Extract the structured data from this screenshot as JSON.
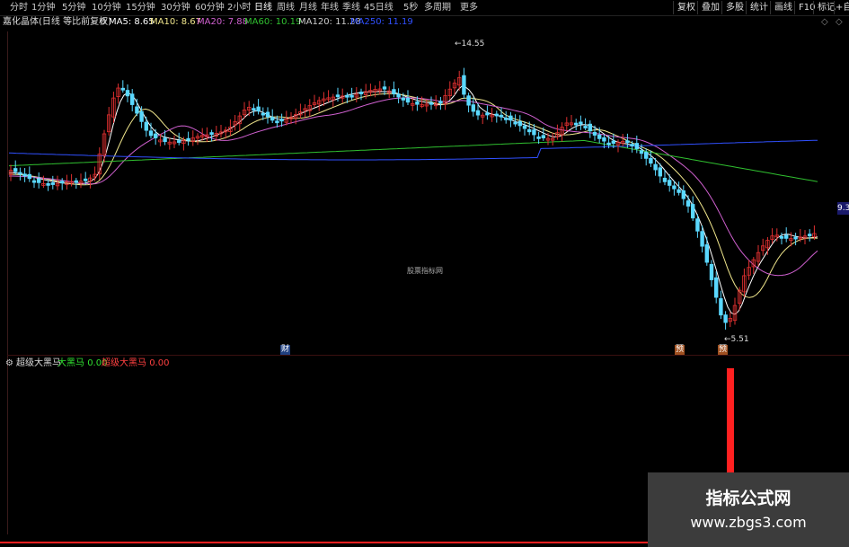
{
  "toolbar": {
    "periods": [
      "分时",
      "1分钟",
      "5分钟",
      "10分钟",
      "15分钟",
      "30分钟",
      "60分钟",
      "2小时",
      "日线",
      "周线",
      "月线",
      "年线",
      "季线",
      "45日线",
      "5秒",
      "多周期",
      "更多"
    ],
    "right_buttons": [
      "复权",
      "叠加",
      "多股",
      "统计",
      "画线",
      "F10",
      "标记",
      "+自选"
    ]
  },
  "info": {
    "title": "嘉化晶体(日线 等比前复权)",
    "ma5": "MA5: 8.65",
    "ma10": "MA10: 8.67",
    "ma20": "MA20: 7.88",
    "ma60": "MA60: 10.19",
    "ma120": "MA120: 11.28",
    "ma250": "MA250: 11.19"
  },
  "chart_data": {
    "type": "candlestick",
    "annotations": {
      "high": "14.55",
      "low": "5.51",
      "right_price": "9.3"
    },
    "center_watermark": "股票指标网",
    "event_markers": [
      "财",
      "预",
      "预"
    ],
    "indicator": {
      "name": "超级大黑马",
      "series": [
        {
          "name": "大黑马",
          "value": "0.00"
        },
        {
          "name": "超级大黑马",
          "value": "0.00"
        }
      ]
    }
  },
  "watermark": {
    "line1": "指标公式网",
    "line2": "www.zbgs3.com"
  },
  "colors": {
    "ma5": "#ffffff",
    "ma10": "#f0e68c",
    "ma20": "#d060d0",
    "ma60": "#30c030",
    "ma120": "#3050ff",
    "up": "#e03030",
    "down": "#5ad8ff",
    "signal": "#ff2020"
  }
}
